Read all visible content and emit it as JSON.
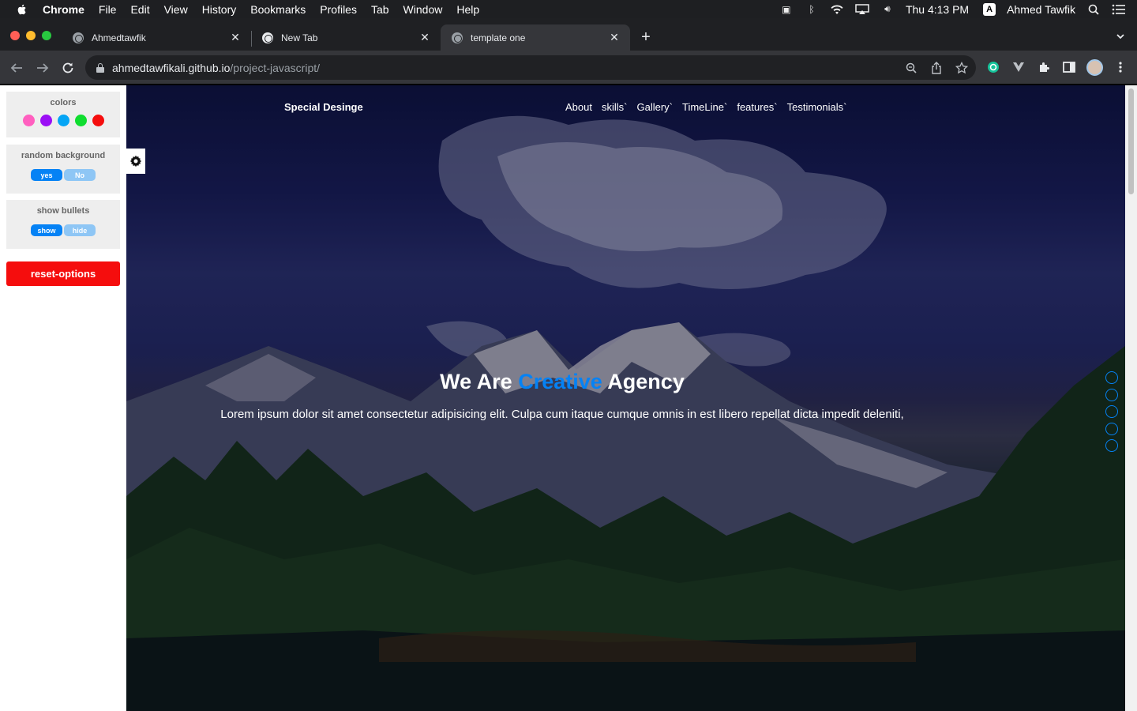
{
  "menubar": {
    "app_name": "Chrome",
    "items": [
      "File",
      "Edit",
      "View",
      "History",
      "Bookmarks",
      "Profiles",
      "Tab",
      "Window",
      "Help"
    ],
    "clock": "Thu 4:13 PM",
    "input_badge": "A",
    "user_name": "Ahmed Tawfik"
  },
  "tabs": [
    {
      "title": "Ahmedtawfik"
    },
    {
      "title": "New Tab"
    },
    {
      "title": "template one"
    }
  ],
  "address_bar": {
    "host": "ahmedtawfikali.github.io",
    "path": "/project-javascript/"
  },
  "settings_panel": {
    "colors_label": "colors",
    "swatches": [
      "#ff5fbf",
      "#9b0ff5",
      "#05a5f5",
      "#0fdd2f",
      "#f50d0d"
    ],
    "random_background_label": "random background",
    "random_yes": "yes",
    "random_no": "No",
    "bullets_label": "show bullets",
    "bullets_show": "show",
    "bullets_hide": "hide",
    "reset_label": "reset-options"
  },
  "site": {
    "logo": "Special Desinge",
    "nav": [
      "About",
      "skills`",
      "Gallery`",
      "TimeLine`",
      "features`",
      "Testimonials`"
    ],
    "hero_title_before": "We Are",
    "hero_title_accent": "Creative",
    "hero_title_after": "Agency",
    "hero_text": "Lorem ipsum dolor sit amet consectetur adipisicing elit. Culpa cum itaque cumque omnis in est libero repellat dicta impedit deleniti,",
    "accent_color": "#0582f5"
  }
}
